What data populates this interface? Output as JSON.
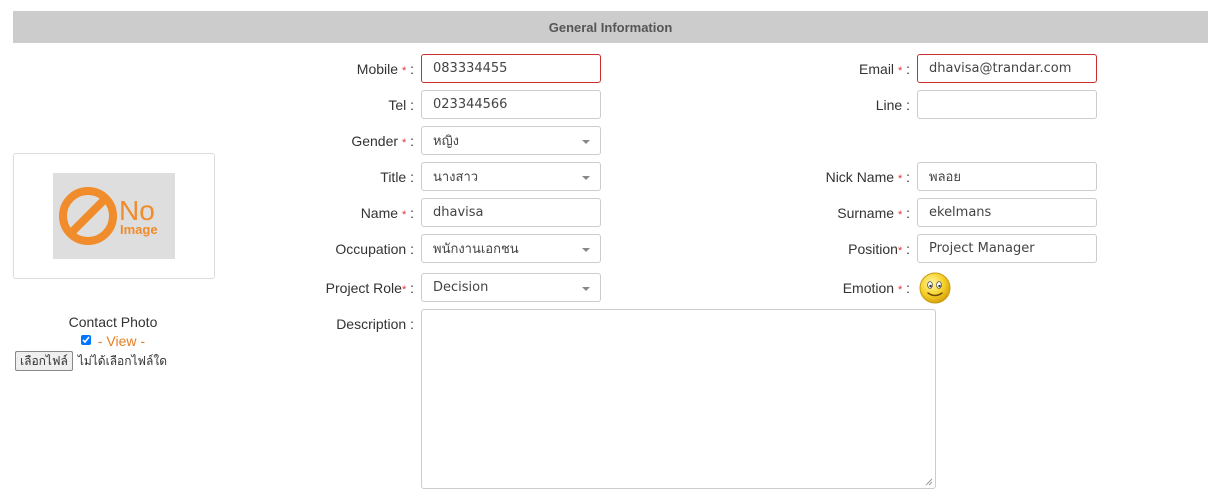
{
  "section": {
    "title": "General Information"
  },
  "photo": {
    "no_image_text": "No",
    "no_image_sub": "Image",
    "caption": "Contact Photo",
    "view_link": "- View -",
    "file_button": "เลือกไฟล์",
    "file_status": "ไม่ได้เลือกไฟล์ใด"
  },
  "form": {
    "mobile": {
      "label": "Mobile",
      "value": "083334455"
    },
    "email": {
      "label": "Email",
      "value": "dhavisa@trandar.com"
    },
    "tel": {
      "label": "Tel :",
      "value": "023344566"
    },
    "line": {
      "label": "Line :",
      "value": ""
    },
    "gender": {
      "label": "Gender",
      "value": "หญิง"
    },
    "title": {
      "label": "Title :",
      "value": "นางสาว"
    },
    "nickname": {
      "label": "Nick Name",
      "value": "พลอย"
    },
    "name": {
      "label": "Name",
      "value": "dhavisa"
    },
    "surname": {
      "label": "Surname",
      "value": "ekelmans"
    },
    "occupation": {
      "label": "Occupation :",
      "value": "พนักงานเอกชน"
    },
    "position": {
      "label": "Position",
      "value": "Project Manager"
    },
    "project_role": {
      "label": "Project Role",
      "value": "Decision"
    },
    "emotion": {
      "label": "Emotion"
    },
    "description": {
      "label": "Description :",
      "value": ""
    }
  },
  "symbols": {
    "required": "*",
    "colon": ":"
  },
  "colors": {
    "accent": "#e67e22",
    "required": "#e0302a",
    "error_border": "#c9302c"
  }
}
